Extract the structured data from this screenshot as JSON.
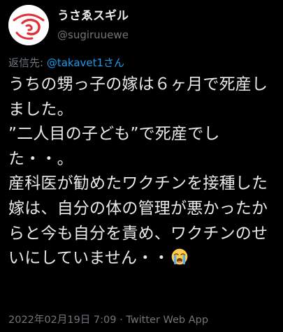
{
  "tweet": {
    "display_name": "うさゑスギル",
    "handle": "@sugiruuewe",
    "reply_prefix": "返信先: ",
    "reply_mention": "@takavet1さん",
    "body": "うちの甥っ子の嫁は６ヶ月で死産しました。\n”二人目の子ども”で死産でした・・。\n産科医が勧めたワクチンを接種した嫁は、自分の体の管理が悪かったからと今も自分を責め、ワクチンのせいにしていません・・",
    "emoji": "loudly-crying-face",
    "date": "2022年02月19日 7:09",
    "separator": " · ",
    "source": "Twitter Web App"
  },
  "colors": {
    "background": "#000000",
    "text": "#e7e9ea",
    "secondary": "#71767b",
    "link": "#1d9bf0",
    "avatar_accent": "#e0303a"
  }
}
